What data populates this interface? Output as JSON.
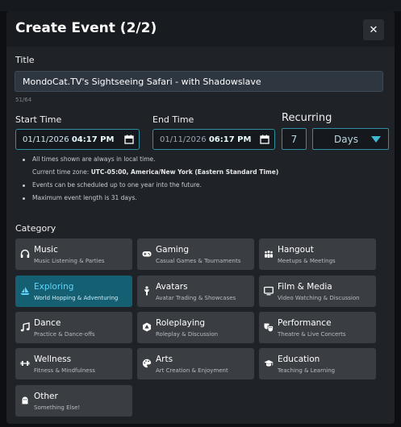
{
  "modal": {
    "title": "Create Event (2/2)",
    "close_glyph": "✕"
  },
  "title_field": {
    "label": "Title",
    "value": "MondoCat.TV's Sightseeing Safari - with Shadowslave",
    "char_count": "51/64"
  },
  "start_time": {
    "label": "Start Time",
    "date": "01/11/2026",
    "time": "04:17 PM"
  },
  "end_time": {
    "label": "End Time",
    "date": "01/11/2026",
    "time": "06:17 PM"
  },
  "recurring": {
    "label": "Recurring",
    "count": "7",
    "unit": "Days"
  },
  "notes": {
    "line1": "All times shown are always in local time.",
    "tz_prefix": "Current time zone: ",
    "tz_value": "UTC-05:00, America/New York (Eastern Standard Time)",
    "line3": "Events can be scheduled up to one year into the future.",
    "line4": "Maximum event length is 31 days."
  },
  "category": {
    "label": "Category",
    "selected": "Exploring",
    "accent_color": "#155f72",
    "items": [
      {
        "name": "Music",
        "subtitle": "Music Listening & Parties",
        "icon": "headphones-icon"
      },
      {
        "name": "Gaming",
        "subtitle": "Casual Games & Tournaments",
        "icon": "gamepad-icon"
      },
      {
        "name": "Hangout",
        "subtitle": "Meetups & Meetings",
        "icon": "people-icon"
      },
      {
        "name": "Exploring",
        "subtitle": "World Hopping & Adventuring",
        "icon": "sailboat-icon"
      },
      {
        "name": "Avatars",
        "subtitle": "Avatar Trading & Showcases",
        "icon": "person-icon"
      },
      {
        "name": "Film & Media",
        "subtitle": "Video Watching & Discussion",
        "icon": "tv-icon"
      },
      {
        "name": "Dance",
        "subtitle": "Practice & Dance-offs",
        "icon": "music-note-icon"
      },
      {
        "name": "Roleplaying",
        "subtitle": "Roleplay & Discussion",
        "icon": "d20-icon"
      },
      {
        "name": "Performance",
        "subtitle": "Theatre & Live Concerts",
        "icon": "masks-icon"
      },
      {
        "name": "Wellness",
        "subtitle": "Fitness & Mindfulness",
        "icon": "dumbbell-icon"
      },
      {
        "name": "Arts",
        "subtitle": "Art Creation & Enjoyment",
        "icon": "palette-icon"
      },
      {
        "name": "Education",
        "subtitle": "Teaching & Learning",
        "icon": "graduation-cap-icon"
      },
      {
        "name": "Other",
        "subtitle": "Something Else!",
        "icon": "ghost-icon"
      }
    ]
  }
}
